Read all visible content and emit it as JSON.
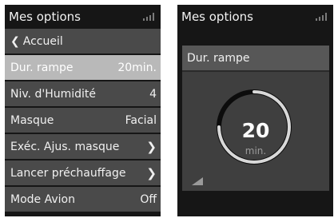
{
  "left_screen": {
    "title": "Mes options",
    "menu": [
      {
        "label": "Accueil",
        "value": "",
        "chevron": false,
        "back": true,
        "selected": false
      },
      {
        "label": "Dur. rampe",
        "value": "20min.",
        "chevron": false,
        "back": false,
        "selected": true
      },
      {
        "label": "Niv. d'Humidité",
        "value": "4",
        "chevron": false,
        "back": false,
        "selected": false
      },
      {
        "label": "Masque",
        "value": "Facial",
        "chevron": false,
        "back": false,
        "selected": false
      },
      {
        "label": "Exéc. Ajus. masque",
        "value": "",
        "chevron": true,
        "back": false,
        "selected": false
      },
      {
        "label": "Lancer préchauffage",
        "value": "",
        "chevron": true,
        "back": false,
        "selected": false
      },
      {
        "label": "Mode Avion",
        "value": "Off",
        "chevron": false,
        "back": false,
        "selected": false
      }
    ]
  },
  "right_screen": {
    "title": "Mes options",
    "panel_title": "Dur. rampe",
    "dial_value": "20",
    "dial_unit": "min."
  },
  "colors": {
    "screen_bg": "#161616",
    "menu_item": "#4a4a4a",
    "menu_selected": "#b9b9b9",
    "dial_track": "#0c0c0c",
    "dial_arc": "#d8d8d8"
  },
  "icons": {
    "signal": "signal-strength-icon",
    "back": "chevron-left-icon",
    "forward": "chevron-right-icon",
    "ramp": "ramp-icon"
  }
}
